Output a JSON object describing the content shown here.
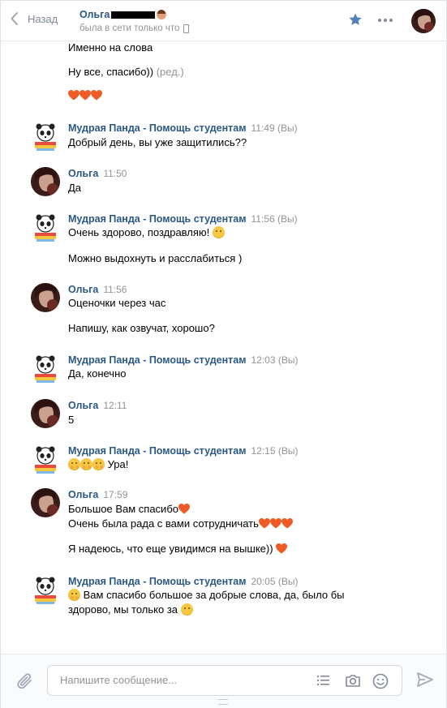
{
  "header": {
    "back_label": "Назад",
    "peer_name": "Ольга",
    "peer_status": "была в сети только что"
  },
  "colors": {
    "link": "#2a5885",
    "muted": "#939393",
    "accent": "#5181b8",
    "heart": "#f05a24"
  },
  "messages": {
    "top_lines": {
      "line1": "Именно на слова",
      "line2": "Ну все, спасибо))",
      "edited": "(ред.)"
    },
    "g1": {
      "author": "Мудрая Панда - Помощь студентам",
      "time": "11:49",
      "you": "(Вы)",
      "text1": "Добрый день, вы уже защитились??"
    },
    "g2": {
      "author": "Ольга",
      "time": "11:50",
      "text1": "Да"
    },
    "g3": {
      "author": "Мудрая Панда - Помощь студентам",
      "time": "11:56",
      "you": "(Вы)",
      "text1": "Очень здорово, поздравляю!",
      "text2": "Можно выдохнуть и расслабиться )"
    },
    "g4": {
      "author": "Ольга",
      "time": "11:56",
      "text1": "Оценочки через час",
      "text2": "Напишу, как озвучат, хорошо?"
    },
    "g5": {
      "author": "Мудрая Панда - Помощь студентам",
      "time": "12:03",
      "you": "(Вы)",
      "text1": "Да, конечно"
    },
    "g6": {
      "author": "Ольга",
      "time": "12:11",
      "text1": "5"
    },
    "g7": {
      "author": "Мудрая Панда - Помощь студентам",
      "time": "12:15",
      "you": "(Вы)",
      "text1": "Ура!"
    },
    "g8": {
      "author": "Ольга",
      "time": "17:59",
      "text1": "Большое Вам спасибо",
      "text2": "Очень была рада с вами сотрудничать",
      "text3": "Я надеюсь, что еще увидимся на вышке))"
    },
    "g9": {
      "author": "Мудрая Панда - Помощь студентам",
      "time": "20:05",
      "you": "(Вы)",
      "text1": "Вам спасибо большое за добрые слова, да, было бы",
      "text2": "здорово, мы только за"
    }
  },
  "composer": {
    "placeholder": "Напишите сообщение..."
  },
  "icons": [
    "chevron-left-icon",
    "star-icon",
    "more-icon",
    "paperclip-icon",
    "list-icon",
    "camera-icon",
    "smile-icon",
    "send-icon",
    "heart-icon",
    "hugging-face-icon",
    "sweat-smile-icon",
    "panda-icon",
    "phone-icon"
  ]
}
